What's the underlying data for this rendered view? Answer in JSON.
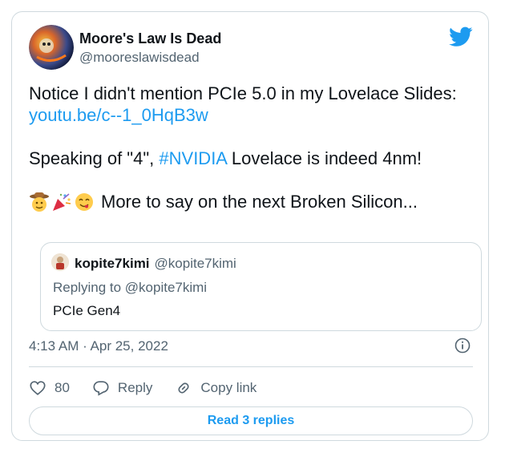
{
  "author": {
    "name": "Moore's Law Is Dead",
    "handle": "@mooreslawisdead",
    "avatar_icon": "avatar-icon",
    "platform_icon": "twitter-bird-icon",
    "brand_color": "#1d9bf0"
  },
  "tweet": {
    "line1_prefix": "Notice I didn't mention PCIe 5.0 in my Lovelace Slides: ",
    "line1_link": "youtu.be/c--1_0HqB3w",
    "line2_prefix": "Speaking of \"4\", ",
    "line2_hashtag": "#NVIDIA",
    "line2_suffix": " Lovelace is indeed 4nm!",
    "line3_text": "More to say on the next Broken Silicon...",
    "emojis": [
      "cowboy-face-emoji",
      "party-popper-emoji",
      "savoring-food-emoji"
    ]
  },
  "quoted": {
    "name": "kopite7kimi",
    "handle": "@kopite7kimi",
    "replying_to": "Replying to @kopite7kimi",
    "text": "PCIe Gen4"
  },
  "timestamp": "4:13 AM · Apr 25, 2022",
  "actions": {
    "like_count": "80",
    "reply_label": "Reply",
    "copy_link_label": "Copy link"
  },
  "read_replies_label": "Read 3 replies"
}
